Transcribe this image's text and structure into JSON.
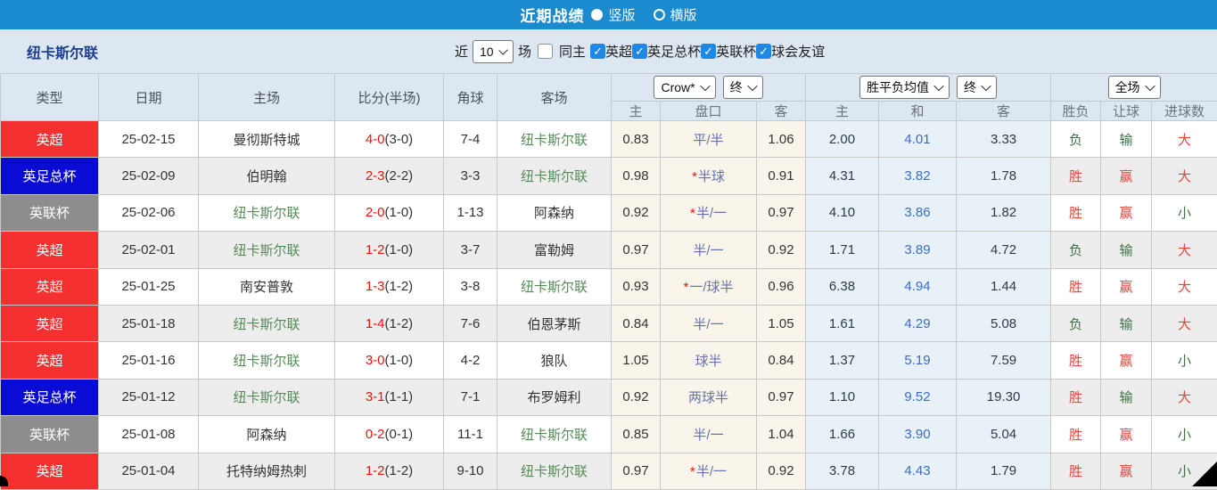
{
  "topbar": {
    "title": "近期战绩",
    "radio_options": [
      {
        "label": "竖版",
        "selected": true
      },
      {
        "label": "横版",
        "selected": false
      }
    ]
  },
  "filterbar": {
    "team": "纽卡斯尔联",
    "near_label": "近",
    "count_value": "10",
    "games_label": "场",
    "same_home": {
      "label": "同主",
      "checked": false
    },
    "competitions": [
      {
        "label": "英超",
        "checked": true
      },
      {
        "label": "英足总杯",
        "checked": true
      },
      {
        "label": "英联杯",
        "checked": true
      },
      {
        "label": "球会友谊",
        "checked": true
      }
    ]
  },
  "table": {
    "main_headers": [
      "类型",
      "日期",
      "主场",
      "比分(半场)",
      "角球",
      "客场"
    ],
    "dropdowns": {
      "odds_source": "Crow*",
      "odds_time": "终",
      "avg_source": "胜平负均值",
      "avg_time": "终",
      "scope": "全场"
    },
    "sub_headers": [
      "主",
      "盘口",
      "客",
      "主",
      "和",
      "客",
      "胜负",
      "让球",
      "进球数"
    ],
    "rows": [
      {
        "type": "英超",
        "type_color": "red",
        "date": "25-02-15",
        "home": "曼彻斯特城",
        "home_is_subject": false,
        "score_ft": "4-0",
        "score_ht": "(3-0)",
        "corners": "7-4",
        "away": "纽卡斯尔联",
        "away_is_subject": true,
        "odds_home": "0.83",
        "handicap_star": false,
        "handicap": "平/半",
        "odds_away": "1.06",
        "avg_home": "2.00",
        "avg_draw": "4.01",
        "avg_away": "3.33",
        "result_wdl": "负",
        "result_wdl_color": "green",
        "result_handicap": "输",
        "result_handicap_color": "green",
        "result_goals": "大",
        "result_goals_color": "red"
      },
      {
        "type": "英足总杯",
        "type_color": "blue",
        "date": "25-02-09",
        "home": "伯明翰",
        "home_is_subject": false,
        "score_ft": "2-3",
        "score_ht": "(2-2)",
        "corners": "3-3",
        "away": "纽卡斯尔联",
        "away_is_subject": true,
        "odds_home": "0.98",
        "handicap_star": true,
        "handicap": "半球",
        "odds_away": "0.91",
        "avg_home": "4.31",
        "avg_draw": "3.82",
        "avg_away": "1.78",
        "result_wdl": "胜",
        "result_wdl_color": "red",
        "result_handicap": "赢",
        "result_handicap_color": "red",
        "result_goals": "大",
        "result_goals_color": "red"
      },
      {
        "type": "英联杯",
        "type_color": "gray",
        "date": "25-02-06",
        "home": "纽卡斯尔联",
        "home_is_subject": true,
        "score_ft": "2-0",
        "score_ht": "(1-0)",
        "corners": "1-13",
        "away": "阿森纳",
        "away_is_subject": false,
        "odds_home": "0.92",
        "handicap_star": true,
        "handicap": "半/一",
        "odds_away": "0.97",
        "avg_home": "4.10",
        "avg_draw": "3.86",
        "avg_away": "1.82",
        "result_wdl": "胜",
        "result_wdl_color": "red",
        "result_handicap": "赢",
        "result_handicap_color": "red",
        "result_goals": "小",
        "result_goals_color": "green"
      },
      {
        "type": "英超",
        "type_color": "red",
        "date": "25-02-01",
        "home": "纽卡斯尔联",
        "home_is_subject": true,
        "score_ft": "1-2",
        "score_ht": "(1-0)",
        "corners": "3-7",
        "away": "富勒姆",
        "away_is_subject": false,
        "odds_home": "0.97",
        "handicap_star": false,
        "handicap": "半/一",
        "odds_away": "0.92",
        "avg_home": "1.71",
        "avg_draw": "3.89",
        "avg_away": "4.72",
        "result_wdl": "负",
        "result_wdl_color": "green",
        "result_handicap": "输",
        "result_handicap_color": "green",
        "result_goals": "大",
        "result_goals_color": "red"
      },
      {
        "type": "英超",
        "type_color": "red",
        "date": "25-01-25",
        "home": "南安普敦",
        "home_is_subject": false,
        "score_ft": "1-3",
        "score_ht": "(1-2)",
        "corners": "3-8",
        "away": "纽卡斯尔联",
        "away_is_subject": true,
        "odds_home": "0.93",
        "handicap_star": true,
        "handicap": "一/球半",
        "odds_away": "0.96",
        "avg_home": "6.38",
        "avg_draw": "4.94",
        "avg_away": "1.44",
        "result_wdl": "胜",
        "result_wdl_color": "red",
        "result_handicap": "赢",
        "result_handicap_color": "red",
        "result_goals": "大",
        "result_goals_color": "red"
      },
      {
        "type": "英超",
        "type_color": "red",
        "date": "25-01-18",
        "home": "纽卡斯尔联",
        "home_is_subject": true,
        "score_ft": "1-4",
        "score_ht": "(1-2)",
        "corners": "7-6",
        "away": "伯恩茅斯",
        "away_is_subject": false,
        "odds_home": "0.84",
        "handicap_star": false,
        "handicap": "半/一",
        "odds_away": "1.05",
        "avg_home": "1.61",
        "avg_draw": "4.29",
        "avg_away": "5.08",
        "result_wdl": "负",
        "result_wdl_color": "green",
        "result_handicap": "输",
        "result_handicap_color": "green",
        "result_goals": "大",
        "result_goals_color": "red"
      },
      {
        "type": "英超",
        "type_color": "red",
        "date": "25-01-16",
        "home": "纽卡斯尔联",
        "home_is_subject": true,
        "score_ft": "3-0",
        "score_ht": "(1-0)",
        "corners": "4-2",
        "away": "狼队",
        "away_is_subject": false,
        "odds_home": "1.05",
        "handicap_star": false,
        "handicap": "球半",
        "odds_away": "0.84",
        "avg_home": "1.37",
        "avg_draw": "5.19",
        "avg_away": "7.59",
        "result_wdl": "胜",
        "result_wdl_color": "red",
        "result_handicap": "赢",
        "result_handicap_color": "red",
        "result_goals": "小",
        "result_goals_color": "green"
      },
      {
        "type": "英足总杯",
        "type_color": "blue",
        "date": "25-01-12",
        "home": "纽卡斯尔联",
        "home_is_subject": true,
        "score_ft": "3-1",
        "score_ht": "(1-1)",
        "corners": "7-1",
        "away": "布罗姆利",
        "away_is_subject": false,
        "odds_home": "0.92",
        "handicap_star": false,
        "handicap": "两球半",
        "odds_away": "0.97",
        "avg_home": "1.10",
        "avg_draw": "9.52",
        "avg_away": "19.30",
        "result_wdl": "胜",
        "result_wdl_color": "red",
        "result_handicap": "输",
        "result_handicap_color": "green",
        "result_goals": "大",
        "result_goals_color": "red"
      },
      {
        "type": "英联杯",
        "type_color": "gray",
        "date": "25-01-08",
        "home": "阿森纳",
        "home_is_subject": false,
        "score_ft": "0-2",
        "score_ht": "(0-1)",
        "corners": "11-1",
        "away": "纽卡斯尔联",
        "away_is_subject": true,
        "odds_home": "0.85",
        "handicap_star": false,
        "handicap": "半/一",
        "odds_away": "1.04",
        "avg_home": "1.66",
        "avg_draw": "3.90",
        "avg_away": "5.04",
        "result_wdl": "胜",
        "result_wdl_color": "red",
        "result_handicap": "赢",
        "result_handicap_color": "red",
        "result_goals": "小",
        "result_goals_color": "green"
      },
      {
        "type": "英超",
        "type_color": "red",
        "date": "25-01-04",
        "home": "托特纳姆热刺",
        "home_is_subject": false,
        "score_ft": "1-2",
        "score_ht": "(1-2)",
        "corners": "9-10",
        "away": "纽卡斯尔联",
        "away_is_subject": true,
        "odds_home": "0.97",
        "handicap_star": true,
        "handicap": "半/一",
        "odds_away": "0.92",
        "avg_home": "3.78",
        "avg_draw": "4.43",
        "avg_away": "1.79",
        "result_wdl": "胜",
        "result_wdl_color": "red",
        "result_handicap": "赢",
        "result_handicap_color": "red",
        "result_goals": "小",
        "result_goals_color": "green"
      }
    ]
  },
  "colors": {
    "topbar_bg": "#1b8bd0",
    "panel_bg": "#dde7f1",
    "type_red": "#f43030",
    "type_blue": "#0b0bd6",
    "type_gray": "#8d8d8d",
    "subject_team_green": "#568b58",
    "score_red": "#ee1111",
    "handicap_blue": "#6672aa",
    "avg_draw_blue": "#3b6cc5",
    "crow_col_bg": "#faf5ea",
    "avg_col_bg": "#e8f1f8",
    "win_red": "#e8433d",
    "lose_green": "#3f7045",
    "checkbox_blue": "#1e88e5"
  }
}
